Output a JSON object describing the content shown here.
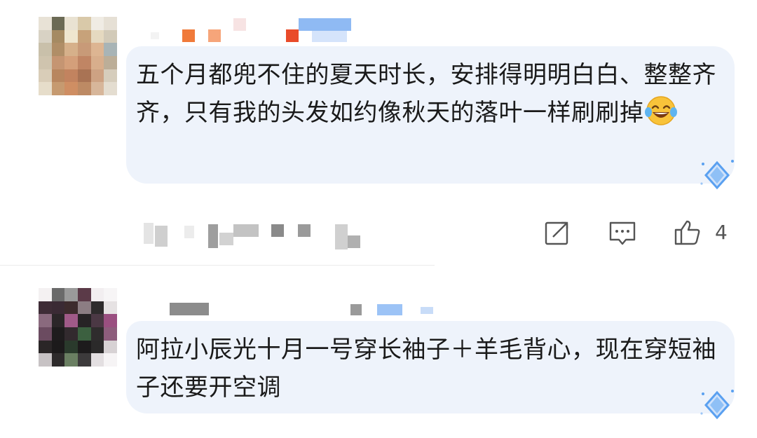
{
  "comments": [
    {
      "text": "五个月都兜不住的夏天时长，安排得明明白白、整整齐齐，只有我的头发如约像秋天的落叶一样刷刷掉",
      "emoji": "laughing-tears-icon",
      "like_count": "4",
      "actions": [
        "share-icon",
        "reply-icon",
        "like-icon"
      ]
    },
    {
      "text": "阿拉小辰光十月一号穿长袖子＋羊毛背心，现在穿短袖子还要开空调"
    }
  ],
  "colors": {
    "bubble": "#eef3fb",
    "text": "#1a1a1a",
    "icon": "#555555",
    "badge": "#5aa0f0"
  }
}
